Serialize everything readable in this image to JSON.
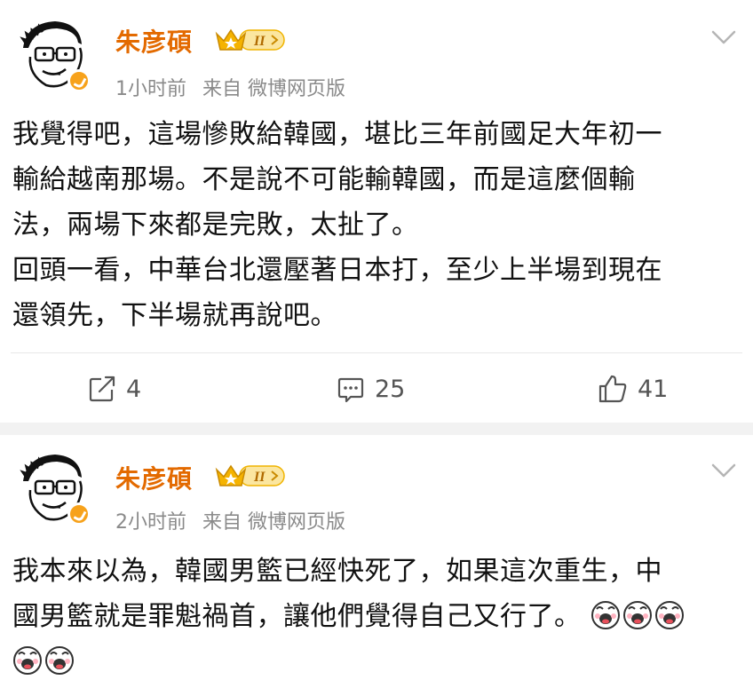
{
  "posts": [
    {
      "username": "朱彦碩",
      "time": "1小时前",
      "source": "来自 微博网页版",
      "lines": [
        "我覺得吧，這場慘敗給韓國，堪比三年前國足大年初一",
        "輸給越南那場。不是說不可能輸韓國，而是這麼個輸",
        "法，兩場下來都是完敗，太扯了。",
        "回頭一看，中華台北還壓著日本打，至少上半場到現在",
        "還領先，下半場就再說吧。"
      ],
      "actions": {
        "share": "4",
        "comment": "25",
        "like": "41"
      }
    },
    {
      "username": "朱彦碩",
      "time": "2小时前",
      "source": "来自 微博网页版",
      "lines": [
        "我本來以為，韓國男籃已經快死了，如果這次重生，中",
        "國男籃就是罪魁禍首，讓他們覺得自己又行了。"
      ]
    }
  ],
  "icons": {
    "avatar": "cartoon-face-avatar",
    "verified": "verified-badge-icon",
    "vip": "vip-crown-badge-icon",
    "menu": "chevron-down-icon",
    "share": "share-icon",
    "comment": "comment-icon",
    "like": "like-icon",
    "emoji": "laughing-face-emoji"
  },
  "colors": {
    "username": "#e36a00",
    "meta": "#8a8a8a",
    "verified": "#f7a21b",
    "vip": "#f5b300"
  }
}
